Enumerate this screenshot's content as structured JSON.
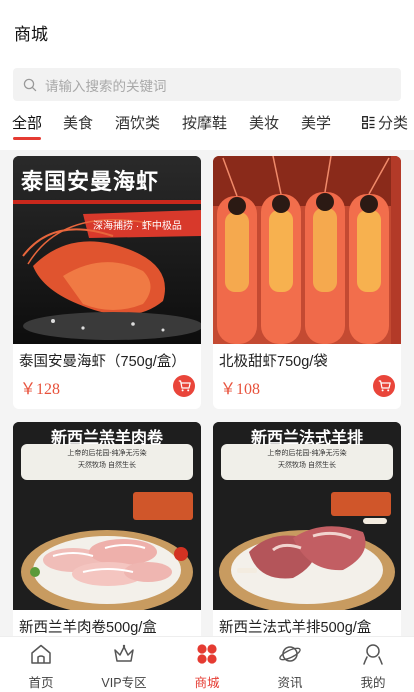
{
  "header": {
    "title": "商城"
  },
  "search": {
    "placeholder": "请输入搜索的关键词"
  },
  "tabs": [
    {
      "label": "全部",
      "active": true
    },
    {
      "label": "美食"
    },
    {
      "label": "酒饮类"
    },
    {
      "label": "按摩鞋"
    },
    {
      "label": "美妆"
    },
    {
      "label": "美学"
    }
  ],
  "category": {
    "label": "分类",
    "icon": "grid-icon"
  },
  "products": [
    {
      "name": "泰国安曼海虾（750g/盒）",
      "price": "￥128",
      "image_text": "泰国安曼海虾",
      "badge_text": "深海捕捞 · 虾中极品"
    },
    {
      "name": "北极甜虾750g/袋",
      "price": "￥108"
    },
    {
      "name": "新西兰羊肉卷500g/盒",
      "image_text": "新西兰羔羊肉卷",
      "sub_text_1": "上帝的后花园-纯净无污染",
      "sub_text_2": "天然牧场 自然生长"
    },
    {
      "name": "新西兰法式羊排500g/盒",
      "image_text": "新西兰法式羊排",
      "sub_text_1": "上帝的后花园-纯净无污染",
      "sub_text_2": "天然牧场 自然生长"
    }
  ],
  "colors": {
    "accent": "#e53b32",
    "price": "#e8523c"
  },
  "tabbar": [
    {
      "label": "首页",
      "icon": "home-icon"
    },
    {
      "label": "VIP专区",
      "icon": "crown-icon"
    },
    {
      "label": "商城",
      "icon": "mall-icon",
      "active": true
    },
    {
      "label": "资讯",
      "icon": "planet-icon"
    },
    {
      "label": "我的",
      "icon": "user-icon"
    }
  ]
}
